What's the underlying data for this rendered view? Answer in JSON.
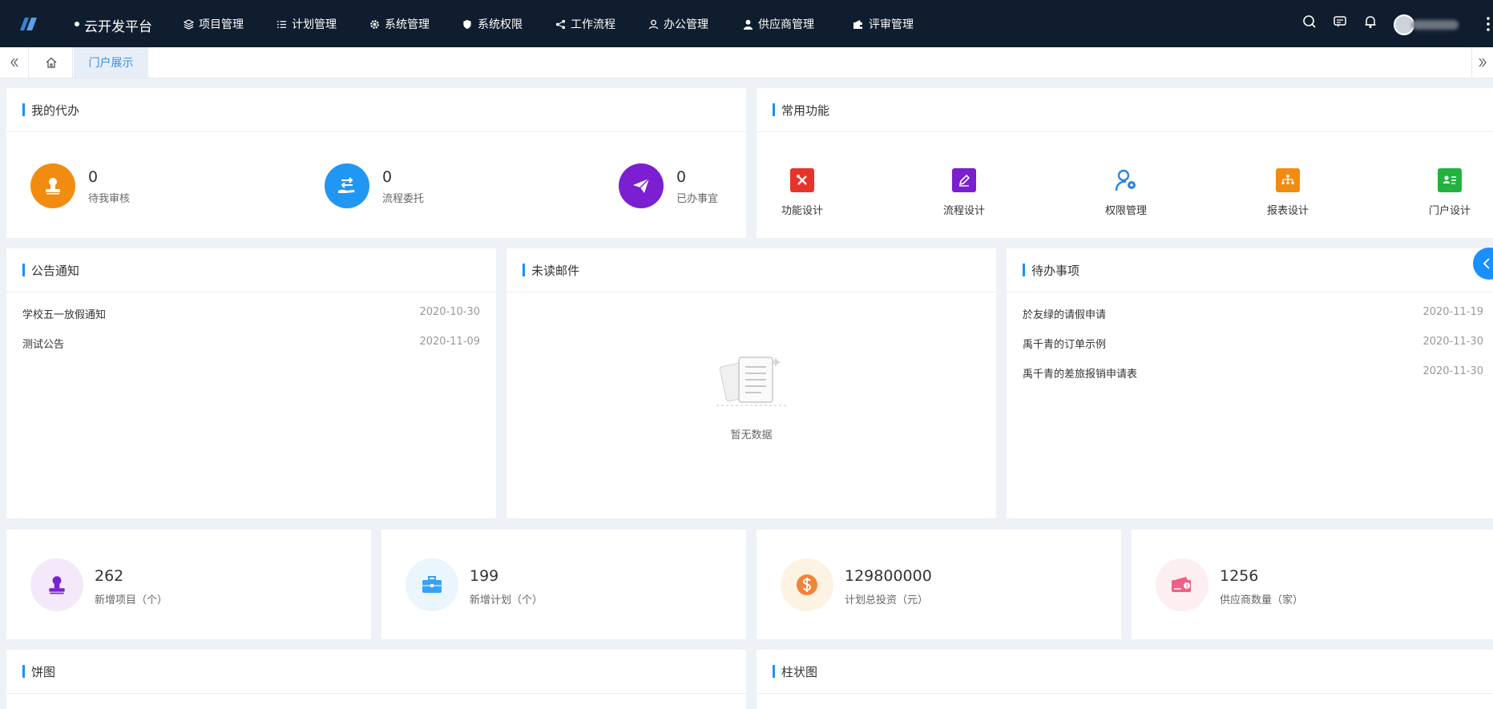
{
  "header": {
    "brand": "云开发平台",
    "nav": [
      {
        "label": "项目管理",
        "icon": "layers-icon"
      },
      {
        "label": "计划管理",
        "icon": "list-icon"
      },
      {
        "label": "系统管理",
        "icon": "gear-icon"
      },
      {
        "label": "系统权限",
        "icon": "shield-icon"
      },
      {
        "label": "工作流程",
        "icon": "share-icon"
      },
      {
        "label": "办公管理",
        "icon": "user-icon"
      },
      {
        "label": "供应商管理",
        "icon": "person-icon"
      },
      {
        "label": "评审管理",
        "icon": "wallet-icon"
      }
    ]
  },
  "tabs": {
    "active": "门户展示"
  },
  "todo": {
    "title": "我的代办",
    "items": [
      {
        "count": "0",
        "label": "待我审核",
        "color": "#f28c11",
        "icon": "stamp-icon"
      },
      {
        "count": "0",
        "label": "流程委托",
        "color": "#2196f3",
        "icon": "transfer-icon"
      },
      {
        "count": "0",
        "label": "已办事宜",
        "color": "#7b1fd1",
        "icon": "paper-plane-icon"
      }
    ]
  },
  "common": {
    "title": "常用功能",
    "items": [
      {
        "label": "功能设计",
        "color": "#e8332a",
        "icon": "tools-icon"
      },
      {
        "label": "流程设计",
        "color": "#7b1fd1",
        "icon": "edit-icon"
      },
      {
        "label": "权限管理",
        "color": "#2b83e8",
        "icon": "user-key-icon"
      },
      {
        "label": "报表设计",
        "color": "#f28c11",
        "icon": "org-chart-icon"
      },
      {
        "label": "门户设计",
        "color": "#22b33e",
        "icon": "id-card-icon"
      }
    ]
  },
  "notice": {
    "title": "公告通知",
    "rows": [
      {
        "title": "学校五一放假通知",
        "date": "2020-10-30"
      },
      {
        "title": "测试公告",
        "date": "2020-11-09"
      }
    ]
  },
  "mail": {
    "title": "未读邮件",
    "empty": "暂无数据"
  },
  "pending": {
    "title": "待办事项",
    "rows": [
      {
        "title": "於友绿的请假申请",
        "date": "2020-11-19"
      },
      {
        "title": "禹千青的订单示例",
        "date": "2020-11-30"
      },
      {
        "title": "禹千青的差旅报销申请表",
        "date": "2020-11-30"
      }
    ]
  },
  "stats": [
    {
      "value": "262",
      "label": "新增项目（个）",
      "bg": "#f3e9fb",
      "fg": "#7b1fd1",
      "icon": "stamp-icon"
    },
    {
      "value": "199",
      "label": "新增计划（个）",
      "bg": "#eaf5fd",
      "fg": "#37a2f4",
      "icon": "toolbox-icon"
    },
    {
      "value": "129800000",
      "label": "计划总投资（元）",
      "bg": "#fdf3e2",
      "fg": "#f2833a",
      "icon": "dollar-coin-icon"
    },
    {
      "value": "1256",
      "label": "供应商数量（家）",
      "bg": "#fdeef1",
      "fg": "#ef5f86",
      "icon": "money-card-icon"
    }
  ],
  "pie": {
    "title": "饼图"
  },
  "bar": {
    "title": "柱状图"
  }
}
